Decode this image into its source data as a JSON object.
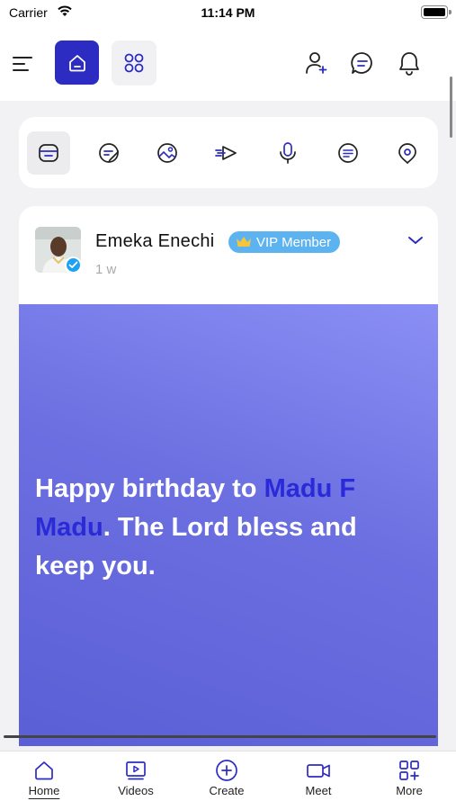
{
  "status_bar": {
    "carrier": "Carrier",
    "time": "11:14 PM"
  },
  "top_bar": {
    "icons": [
      "menu-icon",
      "home-icon",
      "apps-icon",
      "add-user-icon",
      "chat-icon",
      "bell-icon"
    ],
    "accent_color": "#2c2cc2"
  },
  "post_types": {
    "icons": [
      "text-post-icon",
      "sticker-icon",
      "photo-icon",
      "video-icon",
      "mic-icon",
      "message-icon",
      "location-icon"
    ],
    "selected_index": 0
  },
  "feed": {
    "post": {
      "author": "Emeka Enechi",
      "badge": "VIP Member",
      "time": "1 w",
      "text_before": "Happy birthday to ",
      "mention": "Madu F Madu",
      "text_after": ". The Lord bless and keep you.",
      "mention_color": "#2a2ad8"
    }
  },
  "bottom_nav": {
    "items": [
      {
        "label": "Home",
        "icon": "home-icon",
        "active": true
      },
      {
        "label": "Videos",
        "icon": "video-player-icon",
        "active": false
      },
      {
        "label": "Create",
        "icon": "plus-circle-icon",
        "active": false
      },
      {
        "label": "Meet",
        "icon": "camera-icon",
        "active": false
      },
      {
        "label": "More",
        "icon": "grid-plus-icon",
        "active": false
      }
    ]
  }
}
